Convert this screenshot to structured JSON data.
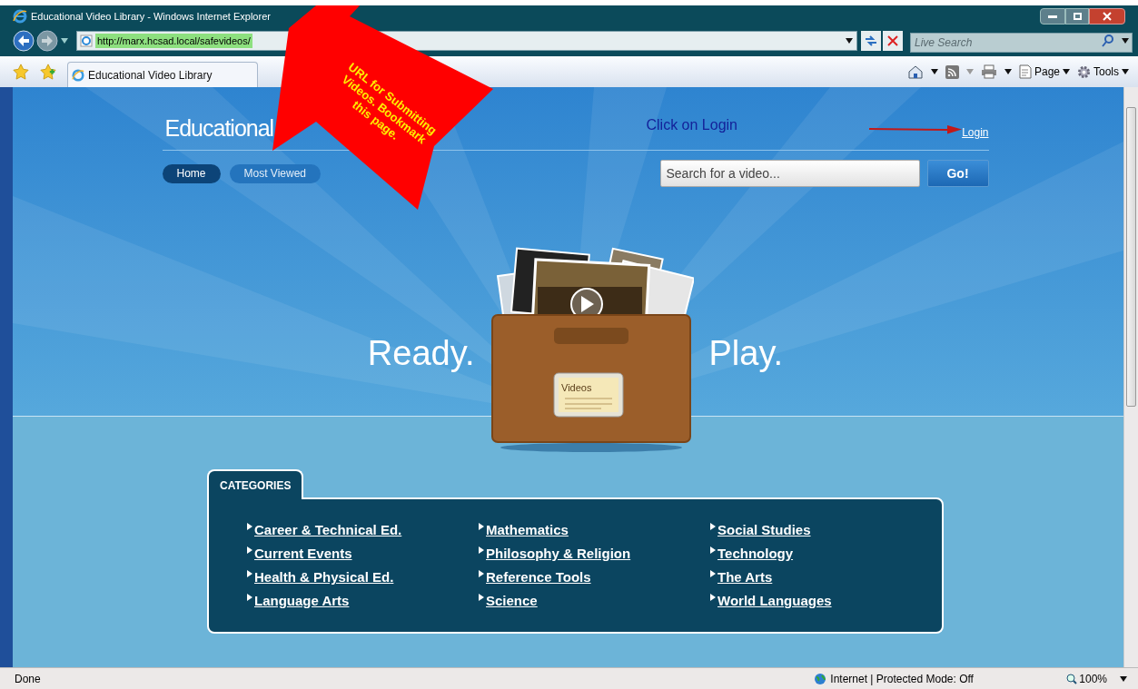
{
  "window": {
    "title": "Educational Video Library - Windows Internet Explorer"
  },
  "address_bar": {
    "url": "http://marx.hcsad.local/safevideos/"
  },
  "search": {
    "placeholder": "Live Search"
  },
  "tab": {
    "title": "Educational Video Library"
  },
  "command_bar": [
    "Page",
    "Tools"
  ],
  "annotations": [
    {
      "kind": "callout",
      "text": "URL for Submitting Videos. Bookmark this page."
    },
    {
      "kind": "note",
      "text": "Click on Login"
    },
    {
      "kind": "arrow"
    }
  ],
  "site": {
    "title": "Educational",
    "login": "Login",
    "nav": [
      {
        "label": "Home",
        "selected": true
      },
      {
        "label": "Most Viewed",
        "selected": false
      }
    ],
    "search": {
      "placeholder": "Search for a video...",
      "button": "Go!"
    }
  },
  "hero": {
    "left": "Ready.",
    "right": "Play.",
    "box_label": "Videos"
  },
  "categories": {
    "title": "CATEGORIES",
    "columns": [
      [
        "Career & Technical Ed.",
        "Current Events",
        "Health & Physical Ed.",
        "Language Arts"
      ],
      [
        "Mathematics",
        "Philosophy & Religion",
        "Reference Tools",
        "Science"
      ],
      [
        "Social Studies",
        "Technology",
        "The Arts",
        "World Languages"
      ]
    ]
  },
  "status_bar": {
    "text": "Done",
    "zone": "Internet | Protected Mode: Off",
    "zoom": "100%"
  }
}
